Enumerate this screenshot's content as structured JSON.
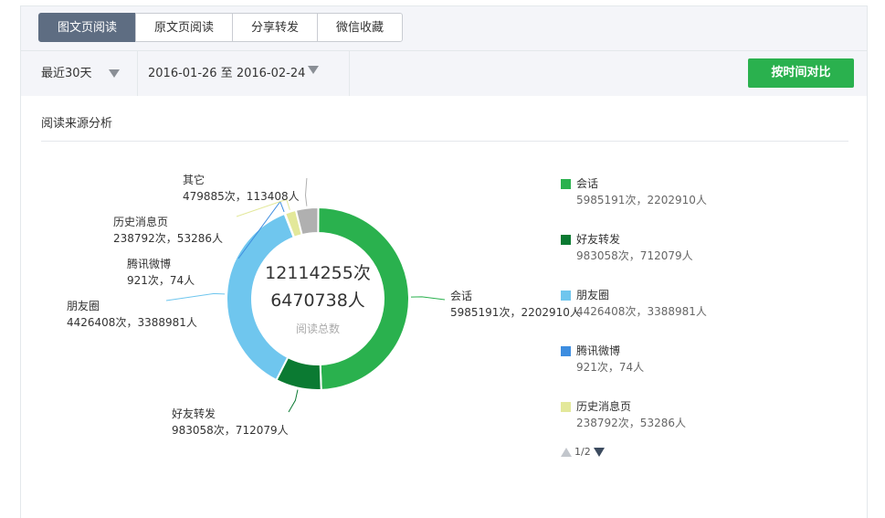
{
  "tabs": [
    {
      "label": "图文页阅读",
      "active": true
    },
    {
      "label": "原文页阅读",
      "active": false
    },
    {
      "label": "分享转发",
      "active": false
    },
    {
      "label": "微信收藏",
      "active": false
    }
  ],
  "filters": {
    "range_label": "最近30天",
    "date_range": "2016-01-26 至 2016-02-24",
    "compare_button": "按时间对比"
  },
  "section_title": "阅读来源分析",
  "chart_data": {
    "type": "pie",
    "variant": "donut",
    "center": {
      "line1": "12114255次",
      "line2": "6470738人",
      "caption": "阅读总数"
    },
    "slices": [
      {
        "name": "会话",
        "value": 5985191,
        "people": 2202910,
        "stats": "5985191次，2202910人",
        "color": "#2ab14e",
        "label_side": "right"
      },
      {
        "name": "好友转发",
        "value": 983058,
        "people": 712079,
        "stats": "983058次，712079人",
        "color": "#0b7a32",
        "label_side": "bottom"
      },
      {
        "name": "朋友圈",
        "value": 4426408,
        "people": 3388981,
        "stats": "4426408次，3388981人",
        "color": "#6fc6ee",
        "label_side": "left"
      },
      {
        "name": "腾讯微博",
        "value": 921,
        "people": 74,
        "stats": "921次，74人",
        "color": "#3d8de0",
        "label_side": "left"
      },
      {
        "name": "历史消息页",
        "value": 238792,
        "people": 53286,
        "stats": "238792次，53286人",
        "color": "#e3e89a",
        "label_side": "left"
      },
      {
        "name": "其它",
        "value": 479885,
        "people": 113408,
        "stats": "479885次，113408人",
        "color": "#b0b0b0",
        "label_side": "top"
      }
    ],
    "legend": {
      "items": [
        {
          "name": "会话",
          "stats": "5985191次，2202910人",
          "color": "#2ab14e"
        },
        {
          "name": "好友转发",
          "stats": "983058次，712079人",
          "color": "#0b7a32"
        },
        {
          "name": "朋友圈",
          "stats": "4426408次，3388981人",
          "color": "#6fc6ee"
        },
        {
          "name": "腾讯微博",
          "stats": "921次，74人",
          "color": "#3d8de0"
        },
        {
          "name": "历史消息页",
          "stats": "238792次，53286人",
          "color": "#e3e89a"
        }
      ],
      "pager": "1/2"
    }
  }
}
